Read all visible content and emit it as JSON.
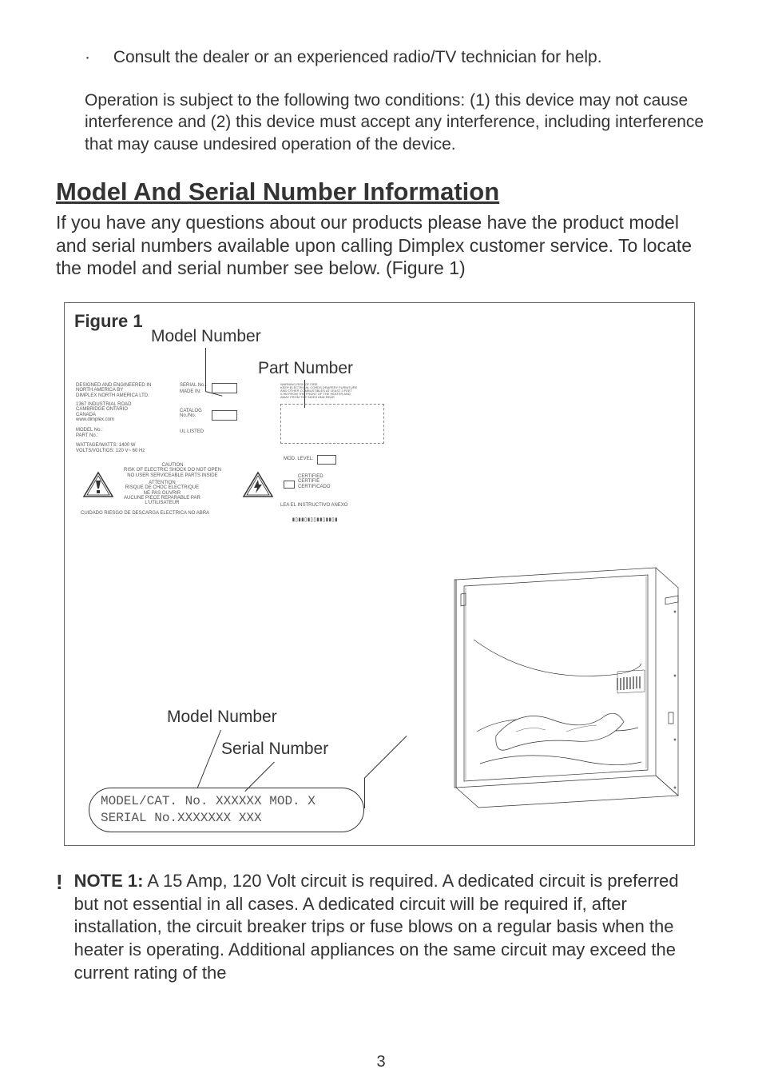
{
  "bullet": {
    "dot": "·",
    "text": "Consult the dealer or an experienced radio/TV technician for help."
  },
  "operation_para": "Operation is subject to the following two conditions: (1) this device may not cause interference and (2) this device must accept any interference, including interference that may cause undesired operation of the device.",
  "section_title": "Model And Serial Number Information",
  "section_para": "If you have any questions about our products please have the product model and serial numbers available upon calling Dimplex customer service. To locate the model and serial number see below. (Figure 1)",
  "figure": {
    "label": "Figure 1",
    "model_number_top": "Model Number",
    "part_number": "Part Number",
    "model_number_bottom": "Model Number",
    "serial_number": "Serial Number",
    "serial_label_line1": "MODEL/CAT. No. XXXXXX MOD. X",
    "serial_label_line2": "SERIAL No.XXXXXXX XXX",
    "plate": {
      "top_left_1": "DESIGNED AND ENGINEERED IN",
      "top_left_2": "NORTH AMERICA BY",
      "top_left_3": "DIMPLEX NORTH AMERICA LTD.",
      "addr_1": "1367 INDUSTRIAL ROAD",
      "addr_2": "CAMBRIDGE ONTARIO",
      "addr_3": "CANADA",
      "addr_4": "www.dimplex.com",
      "model_no": "MODEL No.:",
      "part_no": "PART No.:",
      "serial_no": "SERIAL No.:",
      "made_in": "MADE IN:",
      "wattage": "WATTAGE/WATTS: 1400 W",
      "voltage": "VOLTS/VOLTIOS: 120 V~ 60 Hz",
      "cat_no": "CATALOG\nNo./No.",
      "caution_en": "CAUTION\nRISK OF ELECTRIC SHOCK DO NOT OPEN\nNO USER SERVICEABLE PARTS INSIDE",
      "attention": "ATTENTION\nRISQUE DE CHOC ELECTRIQUE\nNE PAS OUVRIR\nAUCUNE PIECE REPARABLE PAR\nL'UTILISATEUR",
      "cuidado": "CUIDADO RIESGO DE DESCARGA ELECTRICA NO ABRA",
      "mod_level": "MOD. LEVEL:",
      "cert_1": "CERTIFIED",
      "cert_2": "CERTIFIE",
      "cert_3": "CERTIFICADO",
      "listed": "LISTED",
      "lea": "LEA EL INSTRUCTIVO ANEXO",
      "ul_label": "UL LISTED"
    }
  },
  "note": {
    "bang": "!",
    "label": "NOTE 1:",
    "text": "  A 15 Amp, 120 Volt circuit is required.  A dedicated circuit is preferred but not essential in all cases.  A dedicated circuit will be required if, after installation, the circuit breaker trips or fuse blows on a regular basis when the heater is operating.  Additional appliances on the same circuit may exceed the current rating of the"
  },
  "page_number": "3"
}
